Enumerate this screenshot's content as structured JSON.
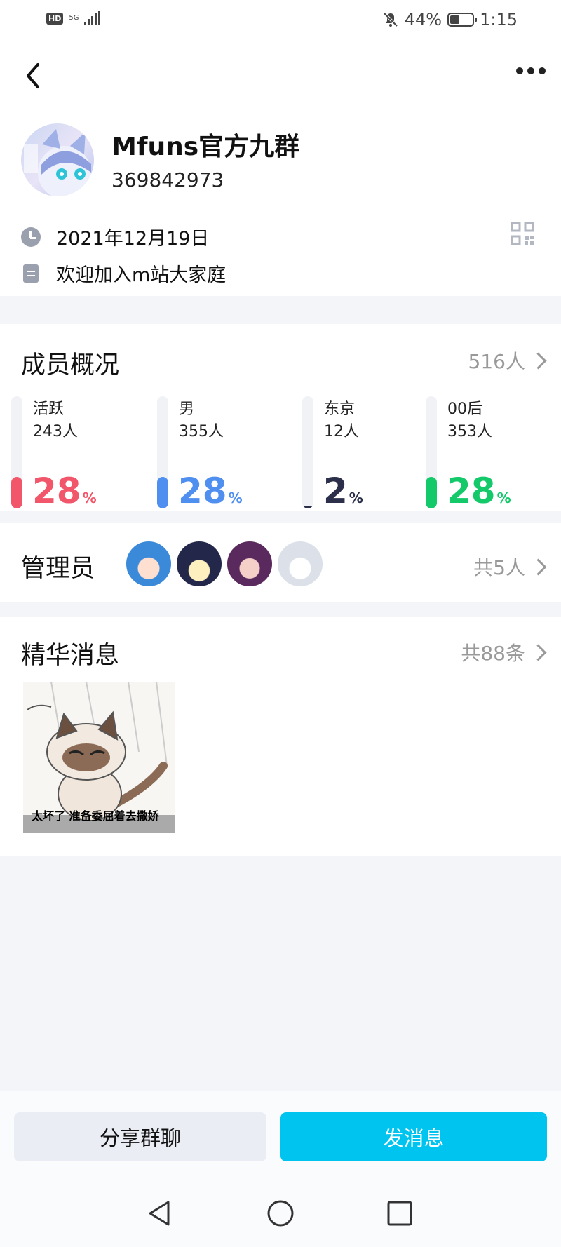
{
  "status_bar": {
    "left_badge": "HD",
    "network": "5G",
    "battery_pct": "44%",
    "battery_level": 0.44,
    "time": "1:15"
  },
  "group": {
    "name": "Mfuns官方九群",
    "id": "369842973",
    "date": "2021年12月19日",
    "intro": "欢迎加入m站大家庭"
  },
  "members": {
    "title": "成员概况",
    "total": "516人",
    "stats": [
      {
        "label": "活跃",
        "count": "243人",
        "percent": "28",
        "unit": "%",
        "color": "#f2566a",
        "level": 0.28
      },
      {
        "label": "男",
        "count": "355人",
        "percent": "28",
        "unit": "%",
        "color": "#4f8ff0",
        "level": 0.28
      },
      {
        "label": "东京",
        "count": "12人",
        "percent": "2",
        "unit": "%",
        "color": "#2b2f4a",
        "level": 0.02
      },
      {
        "label": "00后",
        "count": "353人",
        "percent": "28",
        "unit": "%",
        "color": "#14c96a",
        "level": 0.28
      }
    ]
  },
  "admins": {
    "title": "管理员",
    "total": "共5人"
  },
  "featured": {
    "title": "精华消息",
    "total": "共88条",
    "caption": "太坏了 准备委屈着去撒娇"
  },
  "actions": {
    "share": "分享群聊",
    "send": "发消息"
  },
  "icons": [
    "back-icon",
    "more-icon",
    "clock-icon",
    "document-icon",
    "qr-code-icon",
    "chevron-right-icon",
    "nav-back-icon",
    "nav-home-icon",
    "nav-recents-icon"
  ]
}
